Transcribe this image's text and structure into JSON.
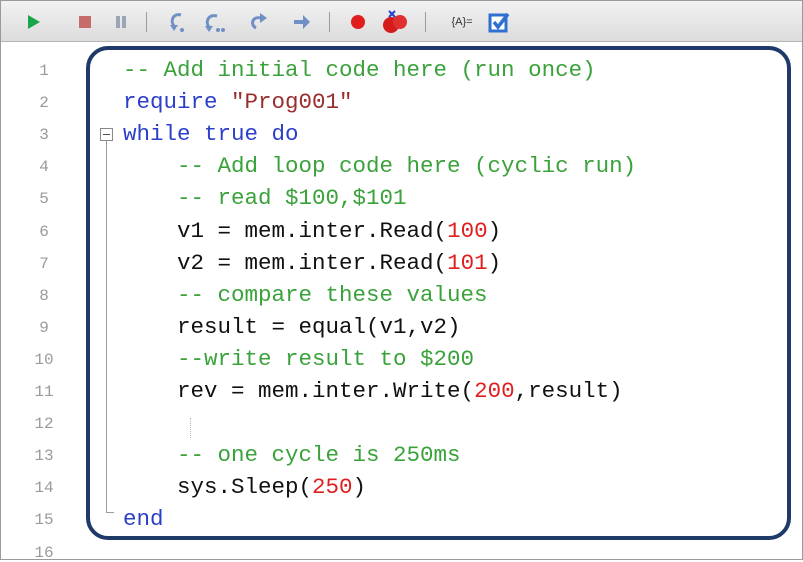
{
  "toolbar": {
    "icons": [
      "run-icon",
      "stop-icon",
      "pause-icon",
      "step-into-icon",
      "step-over-icon",
      "step-back-icon",
      "step-out-icon",
      "breakpoint-icon",
      "clear-breakpoints-icon"
    ],
    "watch_label": "{A}=",
    "colors": {
      "run": "#1aa54a",
      "stop": "#c66a6a",
      "pause": "#9aa6b6",
      "step": "#6f8fc6",
      "breakpoint": "#e01e1e",
      "check": "#2f6fd0"
    }
  },
  "lines": [
    {
      "n": "1",
      "segs": [
        {
          "t": "-- Add initial code here (run once)",
          "c": "cm"
        }
      ]
    },
    {
      "n": "2",
      "segs": [
        {
          "t": "require ",
          "c": "kw"
        },
        {
          "t": "\"Prog001\"",
          "c": "st"
        }
      ]
    },
    {
      "n": "3",
      "segs": [
        {
          "t": "while true do",
          "c": "kw"
        }
      ]
    },
    {
      "n": "4",
      "segs": [
        {
          "t": "    -- Add loop code here (cyclic run)",
          "c": "cm"
        }
      ]
    },
    {
      "n": "5",
      "segs": [
        {
          "t": "    -- read $100,$101",
          "c": "cm"
        }
      ]
    },
    {
      "n": "6",
      "segs": [
        {
          "t": "    v1 = mem.inter.Read(",
          "c": ""
        },
        {
          "t": "100",
          "c": "nm"
        },
        {
          "t": ")",
          "c": ""
        }
      ]
    },
    {
      "n": "7",
      "segs": [
        {
          "t": "    v2 = mem.inter.Read(",
          "c": ""
        },
        {
          "t": "101",
          "c": "nm"
        },
        {
          "t": ")",
          "c": ""
        }
      ]
    },
    {
      "n": "8",
      "segs": [
        {
          "t": "    -- compare these values",
          "c": "cm"
        }
      ]
    },
    {
      "n": "9",
      "segs": [
        {
          "t": "    result = equal(v1,v2)",
          "c": ""
        }
      ]
    },
    {
      "n": "10",
      "segs": [
        {
          "t": "    --write result to $200",
          "c": "cm"
        }
      ]
    },
    {
      "n": "11",
      "segs": [
        {
          "t": "    rev = mem.inter.Write(",
          "c": ""
        },
        {
          "t": "200",
          "c": "nm"
        },
        {
          "t": ",result)",
          "c": ""
        }
      ]
    },
    {
      "n": "12",
      "segs": []
    },
    {
      "n": "13",
      "segs": [
        {
          "t": "    -- one cycle is 250ms",
          "c": "cm"
        }
      ]
    },
    {
      "n": "14",
      "segs": [
        {
          "t": "    sys.Sleep(",
          "c": ""
        },
        {
          "t": "250",
          "c": "nm"
        },
        {
          "t": ")",
          "c": ""
        }
      ]
    },
    {
      "n": "15",
      "segs": [
        {
          "t": "end",
          "c": "kw"
        }
      ]
    },
    {
      "n": "16",
      "segs": []
    }
  ]
}
